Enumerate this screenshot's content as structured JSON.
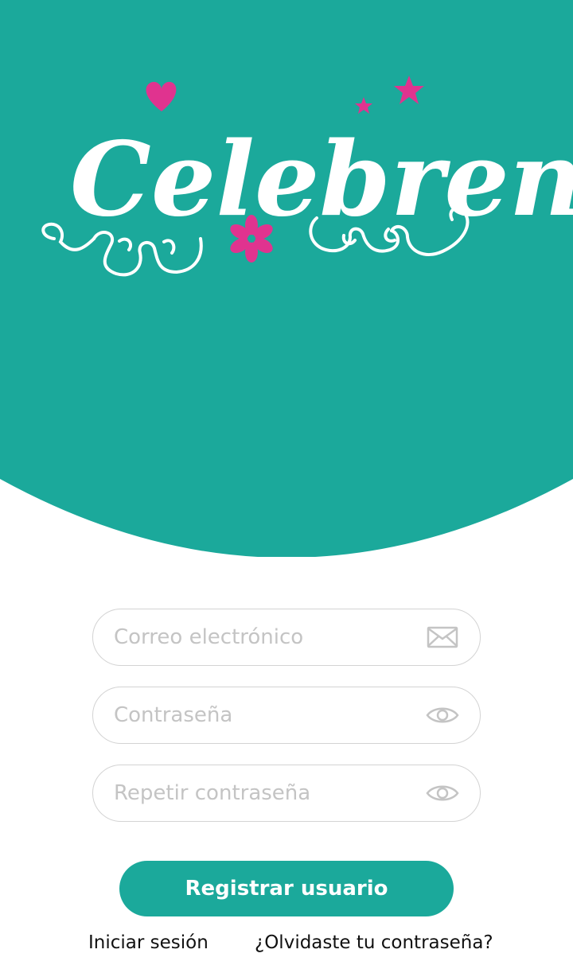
{
  "theme": {
    "primary": "#1ba99b",
    "accent": "#e0338f",
    "field_border": "#d3d3d3",
    "placeholder": "#c4c4c4"
  },
  "logo": {
    "text": "Celebren"
  },
  "form": {
    "email": {
      "placeholder": "Correo electrónico",
      "icon": "envelope-icon"
    },
    "password": {
      "placeholder": "Contraseña",
      "icon": "eye-icon"
    },
    "repeat_password": {
      "placeholder": "Repetir contraseña",
      "icon": "eye-icon"
    },
    "submit_label": "Registrar usuario"
  },
  "links": {
    "login": "Iniciar sesión",
    "forgot": "¿Olvidaste tu contraseña?"
  }
}
